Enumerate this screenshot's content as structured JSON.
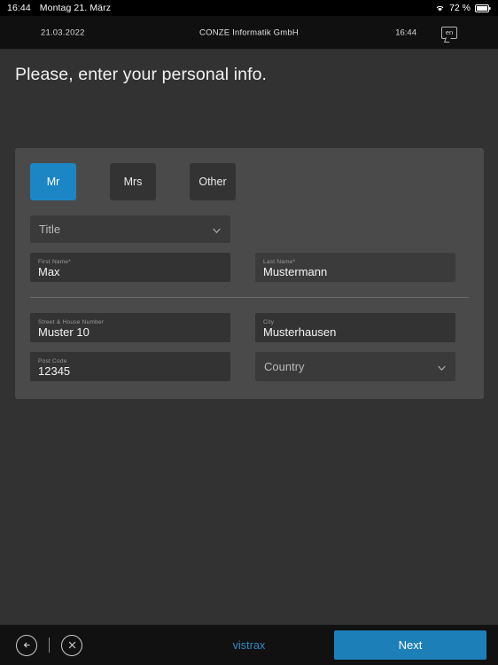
{
  "statusbar": {
    "clock": "16:44",
    "date": "Montag 21. März",
    "battery_percent": "72 %",
    "wifi_icon": "wifi-icon",
    "battery_icon": "battery-icon"
  },
  "header": {
    "date": "21.03.2022",
    "company": "CONZE Informatik GmbH",
    "time": "16:44",
    "language": "en",
    "language_icon": "speech-bubble-icon"
  },
  "page": {
    "title": "Please, enter your personal info."
  },
  "form": {
    "salutations": [
      {
        "label": "Mr",
        "selected": true
      },
      {
        "label": "Mrs",
        "selected": false
      },
      {
        "label": "Other",
        "selected": false
      }
    ],
    "title_select": {
      "label": "Title",
      "value": "",
      "placeholder": "Title",
      "icon": "chevron-down-icon"
    },
    "first_name": {
      "label": "First Name*",
      "value": "Max"
    },
    "last_name": {
      "label": "Last Name*",
      "value": "Mustermann"
    },
    "street": {
      "label": "Street & House Number",
      "value": "Muster 10"
    },
    "city": {
      "label": "City",
      "value": "Musterhausen"
    },
    "post_code": {
      "label": "Post Code",
      "value": "12345"
    },
    "country_select": {
      "label": "Country",
      "value": "",
      "placeholder": "Country",
      "icon": "chevron-down-icon"
    }
  },
  "bottombar": {
    "back_icon": "arrow-left-circle-icon",
    "close_icon": "close-circle-icon",
    "brand": "vistrax",
    "next_label": "Next"
  },
  "colors": {
    "accent_blue": "#1c86c5",
    "button_blue": "#1c7fb8",
    "brand_blue": "#2e8cc4",
    "page_bg": "#323232",
    "panel_bg": "#4a4a4a",
    "field_bg": "#333333",
    "bar_bg": "#111111"
  }
}
